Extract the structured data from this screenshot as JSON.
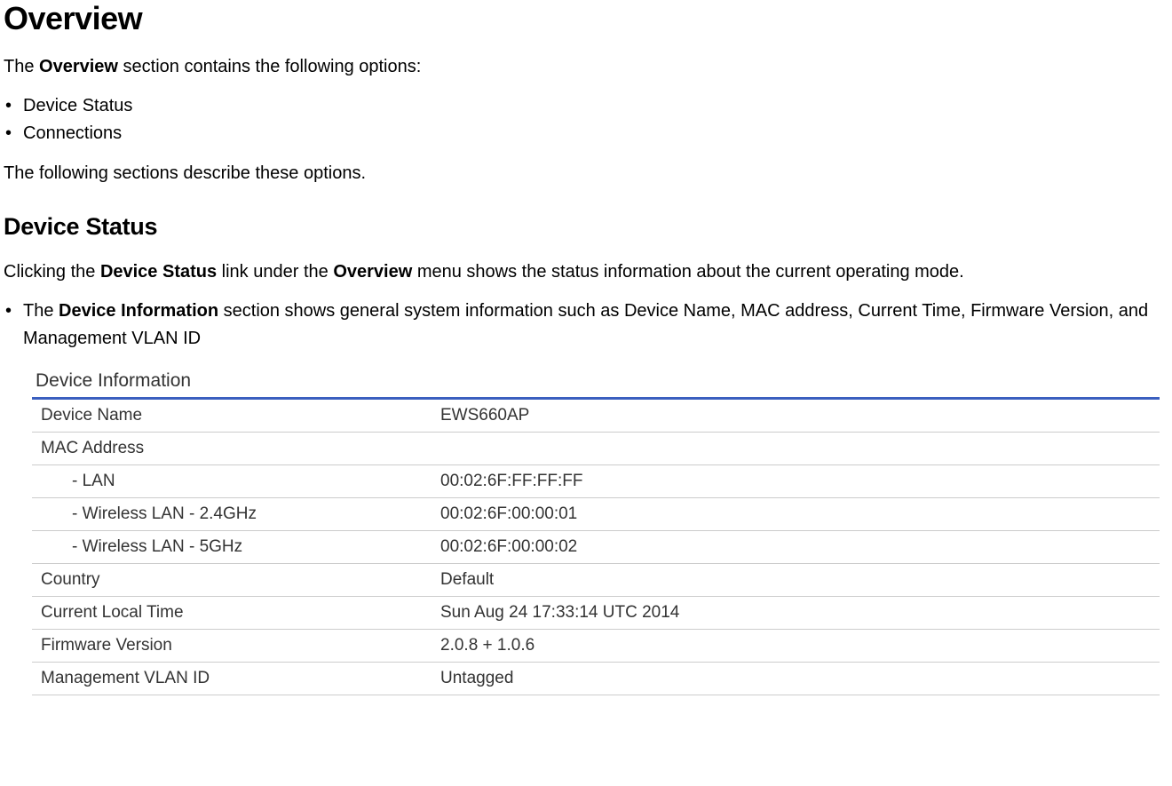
{
  "headings": {
    "overview": "Overview",
    "device_status": "Device Status"
  },
  "intro": {
    "prefix": "The ",
    "bold": "Overview",
    "suffix": " section contains the following options:"
  },
  "options": [
    "Device Status",
    "Connections"
  ],
  "following_text": "The following sections describe these options.",
  "device_status_para": {
    "p1": "Clicking the ",
    "b1": "Device Status",
    "p2": " link under the ",
    "b2": "Overview",
    "p3": " menu shows the status information about the current operating mode."
  },
  "device_info_bullet": {
    "p1": "The ",
    "b1": "Device Information",
    "p2": " section shows general system information such as Device Name, MAC address, Current Time, Firmware Version, and Management VLAN ID"
  },
  "table": {
    "title": "Device Information",
    "rows": [
      {
        "label": "Device Name",
        "value": "EWS660AP",
        "indent": false
      },
      {
        "label": "MAC Address",
        "value": "",
        "indent": false
      },
      {
        "label": "- LAN",
        "value": "00:02:6F:FF:FF:FF",
        "indent": true
      },
      {
        "label": "- Wireless LAN - 2.4GHz",
        "value": "00:02:6F:00:00:01",
        "indent": true
      },
      {
        "label": "- Wireless LAN - 5GHz",
        "value": "00:02:6F:00:00:02",
        "indent": true
      },
      {
        "label": "Country",
        "value": "Default",
        "indent": false
      },
      {
        "label": "Current Local Time",
        "value": "Sun Aug 24 17:33:14 UTC 2014",
        "indent": false
      },
      {
        "label": "Firmware Version",
        "value": "2.0.8 + 1.0.6",
        "indent": false
      },
      {
        "label": "Management VLAN ID",
        "value": "Untagged",
        "indent": false
      }
    ]
  }
}
